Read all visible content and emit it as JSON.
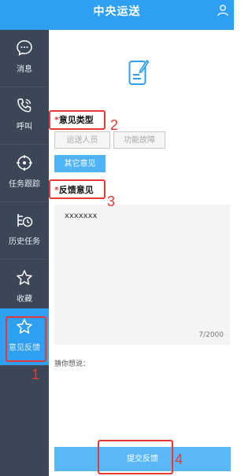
{
  "header": {
    "title": "中央运送",
    "user_icon": "user-icon"
  },
  "sidebar": {
    "items": [
      {
        "label": "消息",
        "icon": "chat-icon"
      },
      {
        "label": "呼叫",
        "icon": "phone-icon"
      },
      {
        "label": "任务跟踪",
        "icon": "target-icon"
      },
      {
        "label": "历史任务",
        "icon": "history-icon"
      },
      {
        "label": "收藏",
        "icon": "star-icon"
      },
      {
        "label": "意见反馈",
        "icon": "star-icon",
        "active": true
      }
    ]
  },
  "form": {
    "type_label": "意见类型",
    "types": [
      "运送人员",
      "功能故障",
      "其它意见"
    ],
    "selected_type": "其它意见",
    "feedback_label": "反馈意见",
    "feedback_value": "xxxxxxx",
    "char_count": "7/2000",
    "guess_label": "猜你想说：",
    "submit_label": "提交反馈",
    "required_mark": "*"
  },
  "annotations": {
    "1": "1",
    "2": "2",
    "3": "3",
    "4": "4"
  },
  "colors": {
    "header": "#2f9ff1",
    "sidebar": "#3b4756",
    "active": "#2f9ff1",
    "annotation": "#e53935",
    "selected": "#4fb3f6"
  }
}
